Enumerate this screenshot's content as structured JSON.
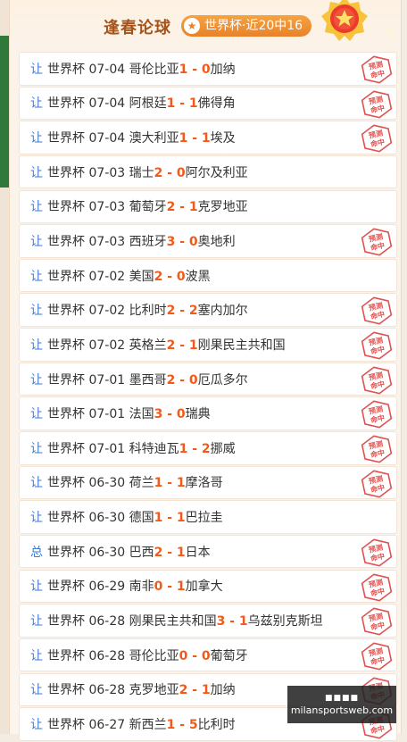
{
  "header": {
    "title": "逢春论球",
    "badge": "世界杯·近20中16"
  },
  "stamp_text": "预测命中",
  "colors": {
    "category": "#3c7ad6",
    "score": "#f05a1a",
    "title": "#a4541a",
    "badge": "#ec8c2f",
    "stamp": "#e0524f"
  },
  "matches": [
    {
      "cat": "让",
      "league": "世界杯",
      "date": "07-04",
      "home": "哥伦比亚",
      "hs": "1",
      "as": "0",
      "away": "加纳",
      "hit": true
    },
    {
      "cat": "让",
      "league": "世界杯",
      "date": "07-04",
      "home": "阿根廷",
      "hs": "1",
      "as": "1",
      "away": "佛得角",
      "hit": true
    },
    {
      "cat": "让",
      "league": "世界杯",
      "date": "07-04",
      "home": "澳大利亚",
      "hs": "1",
      "as": "1",
      "away": "埃及",
      "hit": true
    },
    {
      "cat": "让",
      "league": "世界杯",
      "date": "07-03",
      "home": "瑞士",
      "hs": "2",
      "as": "0",
      "away": "阿尔及利亚",
      "hit": false
    },
    {
      "cat": "让",
      "league": "世界杯",
      "date": "07-03",
      "home": "葡萄牙",
      "hs": "2",
      "as": "1",
      "away": "克罗地亚",
      "hit": false
    },
    {
      "cat": "让",
      "league": "世界杯",
      "date": "07-03",
      "home": "西班牙",
      "hs": "3",
      "as": "0",
      "away": "奥地利",
      "hit": true
    },
    {
      "cat": "让",
      "league": "世界杯",
      "date": "07-02",
      "home": "美国",
      "hs": "2",
      "as": "0",
      "away": "波黑",
      "hit": false
    },
    {
      "cat": "让",
      "league": "世界杯",
      "date": "07-02",
      "home": "比利时",
      "hs": "2",
      "as": "2",
      "away": "塞内加尔",
      "hit": true
    },
    {
      "cat": "让",
      "league": "世界杯",
      "date": "07-02",
      "home": "英格兰",
      "hs": "2",
      "as": "1",
      "away": "刚果民主共和国",
      "hit": true
    },
    {
      "cat": "让",
      "league": "世界杯",
      "date": "07-01",
      "home": "墨西哥",
      "hs": "2",
      "as": "0",
      "away": "厄瓜多尔",
      "hit": true
    },
    {
      "cat": "让",
      "league": "世界杯",
      "date": "07-01",
      "home": "法国",
      "hs": "3",
      "as": "0",
      "away": "瑞典",
      "hit": true
    },
    {
      "cat": "让",
      "league": "世界杯",
      "date": "07-01",
      "home": "科特迪瓦",
      "hs": "1",
      "as": "2",
      "away": "挪威",
      "hit": true
    },
    {
      "cat": "让",
      "league": "世界杯",
      "date": "06-30",
      "home": "荷兰",
      "hs": "1",
      "as": "1",
      "away": "摩洛哥",
      "hit": true
    },
    {
      "cat": "让",
      "league": "世界杯",
      "date": "06-30",
      "home": "德国",
      "hs": "1",
      "as": "1",
      "away": "巴拉圭",
      "hit": false
    },
    {
      "cat": "总",
      "league": "世界杯",
      "date": "06-30",
      "home": "巴西",
      "hs": "2",
      "as": "1",
      "away": "日本",
      "hit": true
    },
    {
      "cat": "让",
      "league": "世界杯",
      "date": "06-29",
      "home": "南非",
      "hs": "0",
      "as": "1",
      "away": "加拿大",
      "hit": true
    },
    {
      "cat": "让",
      "league": "世界杯",
      "date": "06-28",
      "home": "刚果民主共和国",
      "hs": "3",
      "as": "1",
      "away": "乌兹别克斯坦",
      "hit": true
    },
    {
      "cat": "让",
      "league": "世界杯",
      "date": "06-28",
      "home": "哥伦比亚",
      "hs": "0",
      "as": "0",
      "away": "葡萄牙",
      "hit": true
    },
    {
      "cat": "让",
      "league": "世界杯",
      "date": "06-28",
      "home": "克罗地亚",
      "hs": "2",
      "as": "1",
      "away": "加纳",
      "hit": true
    },
    {
      "cat": "让",
      "league": "世界杯",
      "date": "06-27",
      "home": "新西兰",
      "hs": "1",
      "as": "5",
      "away": "比利时",
      "hit": true
    }
  ],
  "watermark": {
    "line1": "■■■■",
    "line2": "milansportsweb.com"
  }
}
